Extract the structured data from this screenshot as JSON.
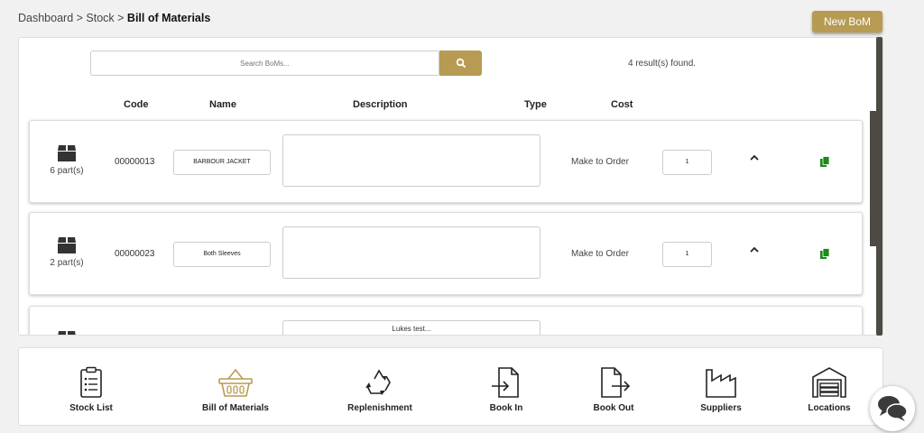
{
  "breadcrumb": {
    "part1": "Dashboard",
    "sep1": " > ",
    "part2": "Stock",
    "sep2": " > ",
    "current": "Bill of Materials"
  },
  "header": {
    "new_button": "New BoM"
  },
  "search": {
    "placeholder": "Search BoMs...",
    "results": "4 result(s) found."
  },
  "columns": {
    "code": "Code",
    "name": "Name",
    "description": "Description",
    "type": "Type",
    "cost": "Cost"
  },
  "rows": [
    {
      "parts": "6 part(s)",
      "code": "00000013",
      "name": "BARBOUR JACKET",
      "description": "",
      "type": "Make to Order",
      "qty": "1"
    },
    {
      "parts": "2 part(s)",
      "code": "00000023",
      "name": "Both Sleeves",
      "description": "",
      "type": "Make to Order",
      "qty": "1"
    },
    {
      "parts": "",
      "code": "",
      "name": "",
      "description": "Lukes test...",
      "type": "",
      "qty": ""
    }
  ],
  "nav": [
    {
      "label": "Stock List",
      "icon": "clipboard-list-icon"
    },
    {
      "label": "Bill of Materials",
      "icon": "basket-icon"
    },
    {
      "label": "Replenishment",
      "icon": "recycle-icon"
    },
    {
      "label": "Book In",
      "icon": "file-import-icon"
    },
    {
      "label": "Book Out",
      "icon": "file-export-icon"
    },
    {
      "label": "Suppliers",
      "icon": "factory-icon"
    },
    {
      "label": "Locations",
      "icon": "warehouse-icon"
    }
  ],
  "colors": {
    "accent": "#b79b52",
    "copy_icon": "#1a8a1a",
    "scrollbar": "#4d4a43"
  }
}
